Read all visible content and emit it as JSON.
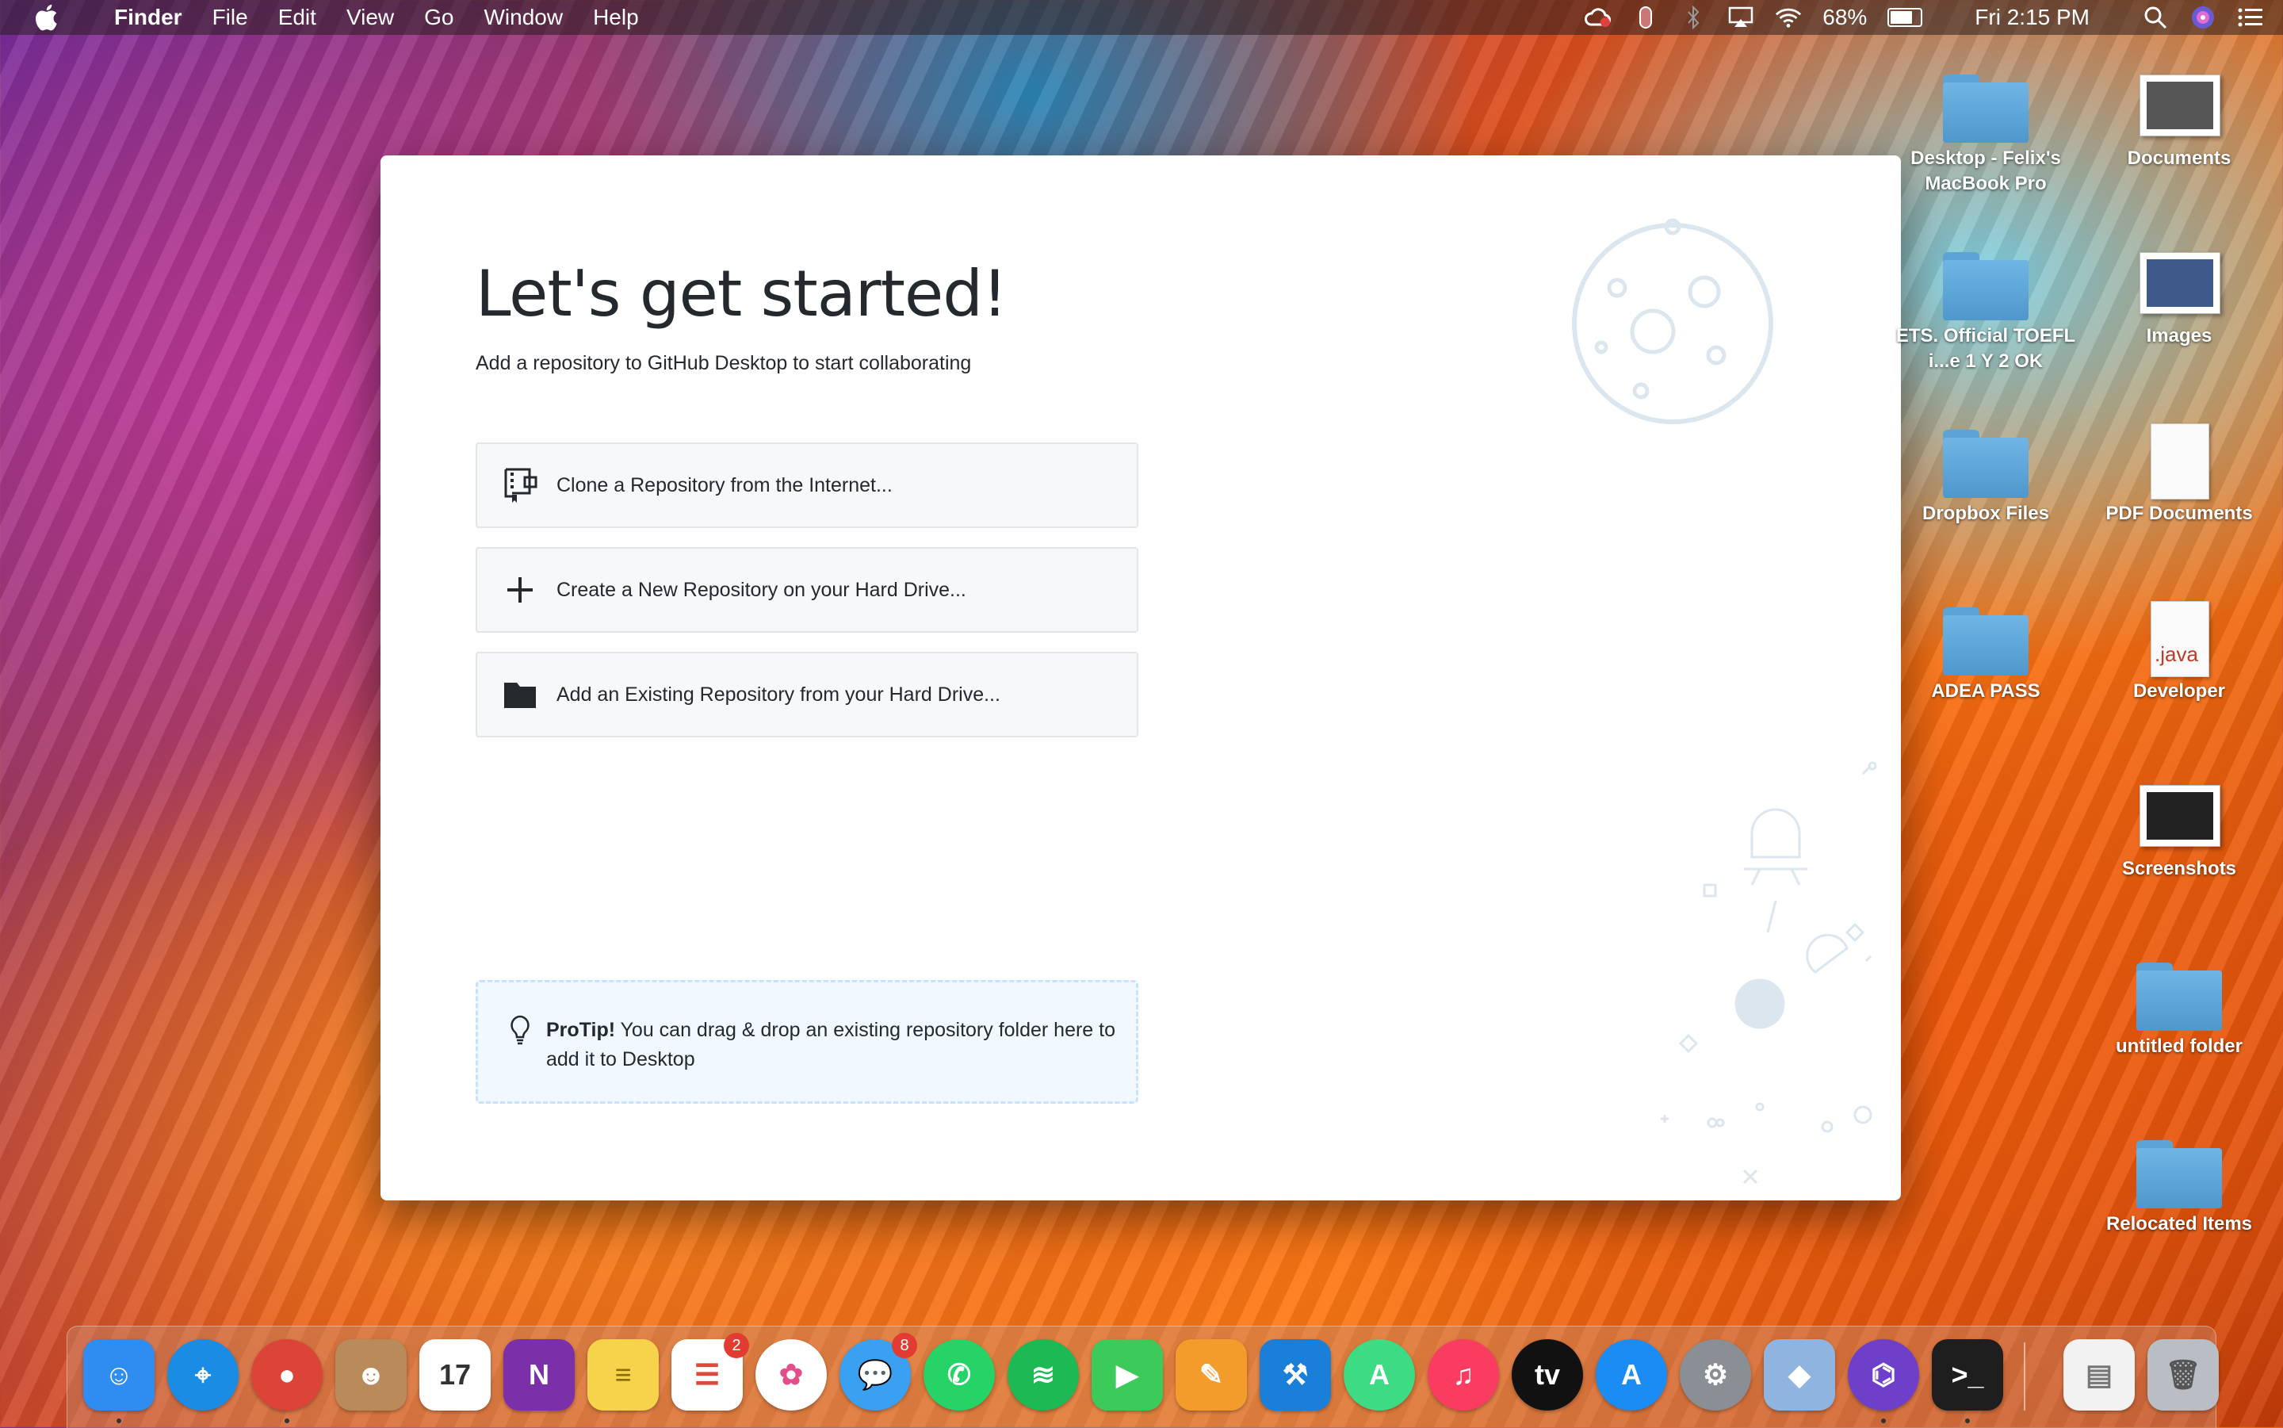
{
  "menubar": {
    "app_name": "Finder",
    "menus": [
      "File",
      "Edit",
      "View",
      "Go",
      "Window",
      "Help"
    ],
    "battery_percent": "68%",
    "clock": "Fri 2:15 PM"
  },
  "window": {
    "title": "Let's get started!",
    "subtitle": "Add a repository to GitHub Desktop to start collaborating",
    "actions": [
      {
        "label": "Clone a Repository from the Internet...",
        "icon": "clone-repo-icon"
      },
      {
        "label": "Create a New Repository on your Hard Drive...",
        "icon": "plus-icon"
      },
      {
        "label": "Add an Existing Repository from your Hard Drive...",
        "icon": "folder-icon"
      }
    ],
    "protip": {
      "bold": "ProTip!",
      "text": " You can drag & drop an existing repository folder here to add it to Desktop"
    }
  },
  "desktop": {
    "icons": [
      {
        "label": "Desktop - Felix's MacBook Pro",
        "type": "folder"
      },
      {
        "label": "Documents",
        "type": "photo"
      },
      {
        "label": "ETS. Official TOEFL i...e 1 Y 2 OK",
        "type": "folder"
      },
      {
        "label": "Images",
        "type": "photo"
      },
      {
        "label": "Dropbox Files",
        "type": "folder"
      },
      {
        "label": "PDF Documents",
        "type": "doc"
      },
      {
        "label": "ADEA PASS",
        "type": "folder"
      },
      {
        "label": "Developer",
        "type": "doc",
        "doc_text": ".java"
      },
      {
        "label": "Screenshots",
        "type": "photo"
      },
      {
        "label": "untitled folder",
        "type": "folder"
      },
      {
        "label": "Relocated Items",
        "type": "folder"
      }
    ]
  },
  "dock": {
    "apps": [
      {
        "name": "finder-icon",
        "glyph": "☺",
        "color": "#2f8cf0"
      },
      {
        "name": "safari-icon",
        "glyph": "⌖",
        "color": "#1b8ce3",
        "round": true
      },
      {
        "name": "chrome-icon",
        "glyph": "●",
        "color": "#db4437",
        "round": true
      },
      {
        "name": "contacts-icon",
        "glyph": "☻",
        "color": "#b98a5a"
      },
      {
        "name": "calendar-icon",
        "glyph": "17",
        "color": "#ffffff",
        "text_color": "#333333"
      },
      {
        "name": "onenote-icon",
        "glyph": "N",
        "color": "#7b2fa8"
      },
      {
        "name": "notes-icon",
        "glyph": "≡",
        "color": "#f7d34b",
        "text_color": "#8a6d00"
      },
      {
        "name": "reminders-icon",
        "glyph": "☰",
        "color": "#ffffff",
        "text_color": "#e0473d",
        "badge": "2"
      },
      {
        "name": "photos-icon",
        "glyph": "✿",
        "color": "#ffffff",
        "text_color": "#e24d8a",
        "round": true
      },
      {
        "name": "messages-icon",
        "glyph": "💬",
        "color": "#3aa0f2",
        "round": true,
        "badge": "8"
      },
      {
        "name": "whatsapp-icon",
        "glyph": "✆",
        "color": "#25d366",
        "round": true
      },
      {
        "name": "spotify-icon",
        "glyph": "≋",
        "color": "#1db954",
        "round": true
      },
      {
        "name": "facetime-icon",
        "glyph": "▶",
        "color": "#3ccb5a"
      },
      {
        "name": "pages-icon",
        "glyph": "✎",
        "color": "#f39b2b"
      },
      {
        "name": "xcode-icon",
        "glyph": "⚒",
        "color": "#1a7fd8"
      },
      {
        "name": "android-studio-icon",
        "glyph": "A",
        "color": "#3ddc84",
        "round": true
      },
      {
        "name": "music-icon",
        "glyph": "♫",
        "color": "#fb3c61",
        "round": true
      },
      {
        "name": "apple-tv-icon",
        "glyph": "tv",
        "color": "#111111",
        "round": true
      },
      {
        "name": "app-store-icon",
        "glyph": "A",
        "color": "#1a8cf3",
        "round": true
      },
      {
        "name": "system-preferences-icon",
        "glyph": "⚙",
        "color": "#8a8f96",
        "round": true
      },
      {
        "name": "virtualbox-icon",
        "glyph": "◆",
        "color": "#8fb4e0"
      },
      {
        "name": "github-desktop-icon",
        "glyph": "⌬",
        "color": "#6e40c9",
        "round": true
      },
      {
        "name": "terminal-icon",
        "glyph": ">_",
        "color": "#1e1e1e"
      },
      {
        "name": "pdf-document-icon",
        "glyph": "▤",
        "color": "#f2f2f2",
        "text_color": "#777777"
      },
      {
        "name": "trash-icon",
        "glyph": "🗑",
        "color": "#b9bec4",
        "text_color": "#555555"
      }
    ]
  }
}
